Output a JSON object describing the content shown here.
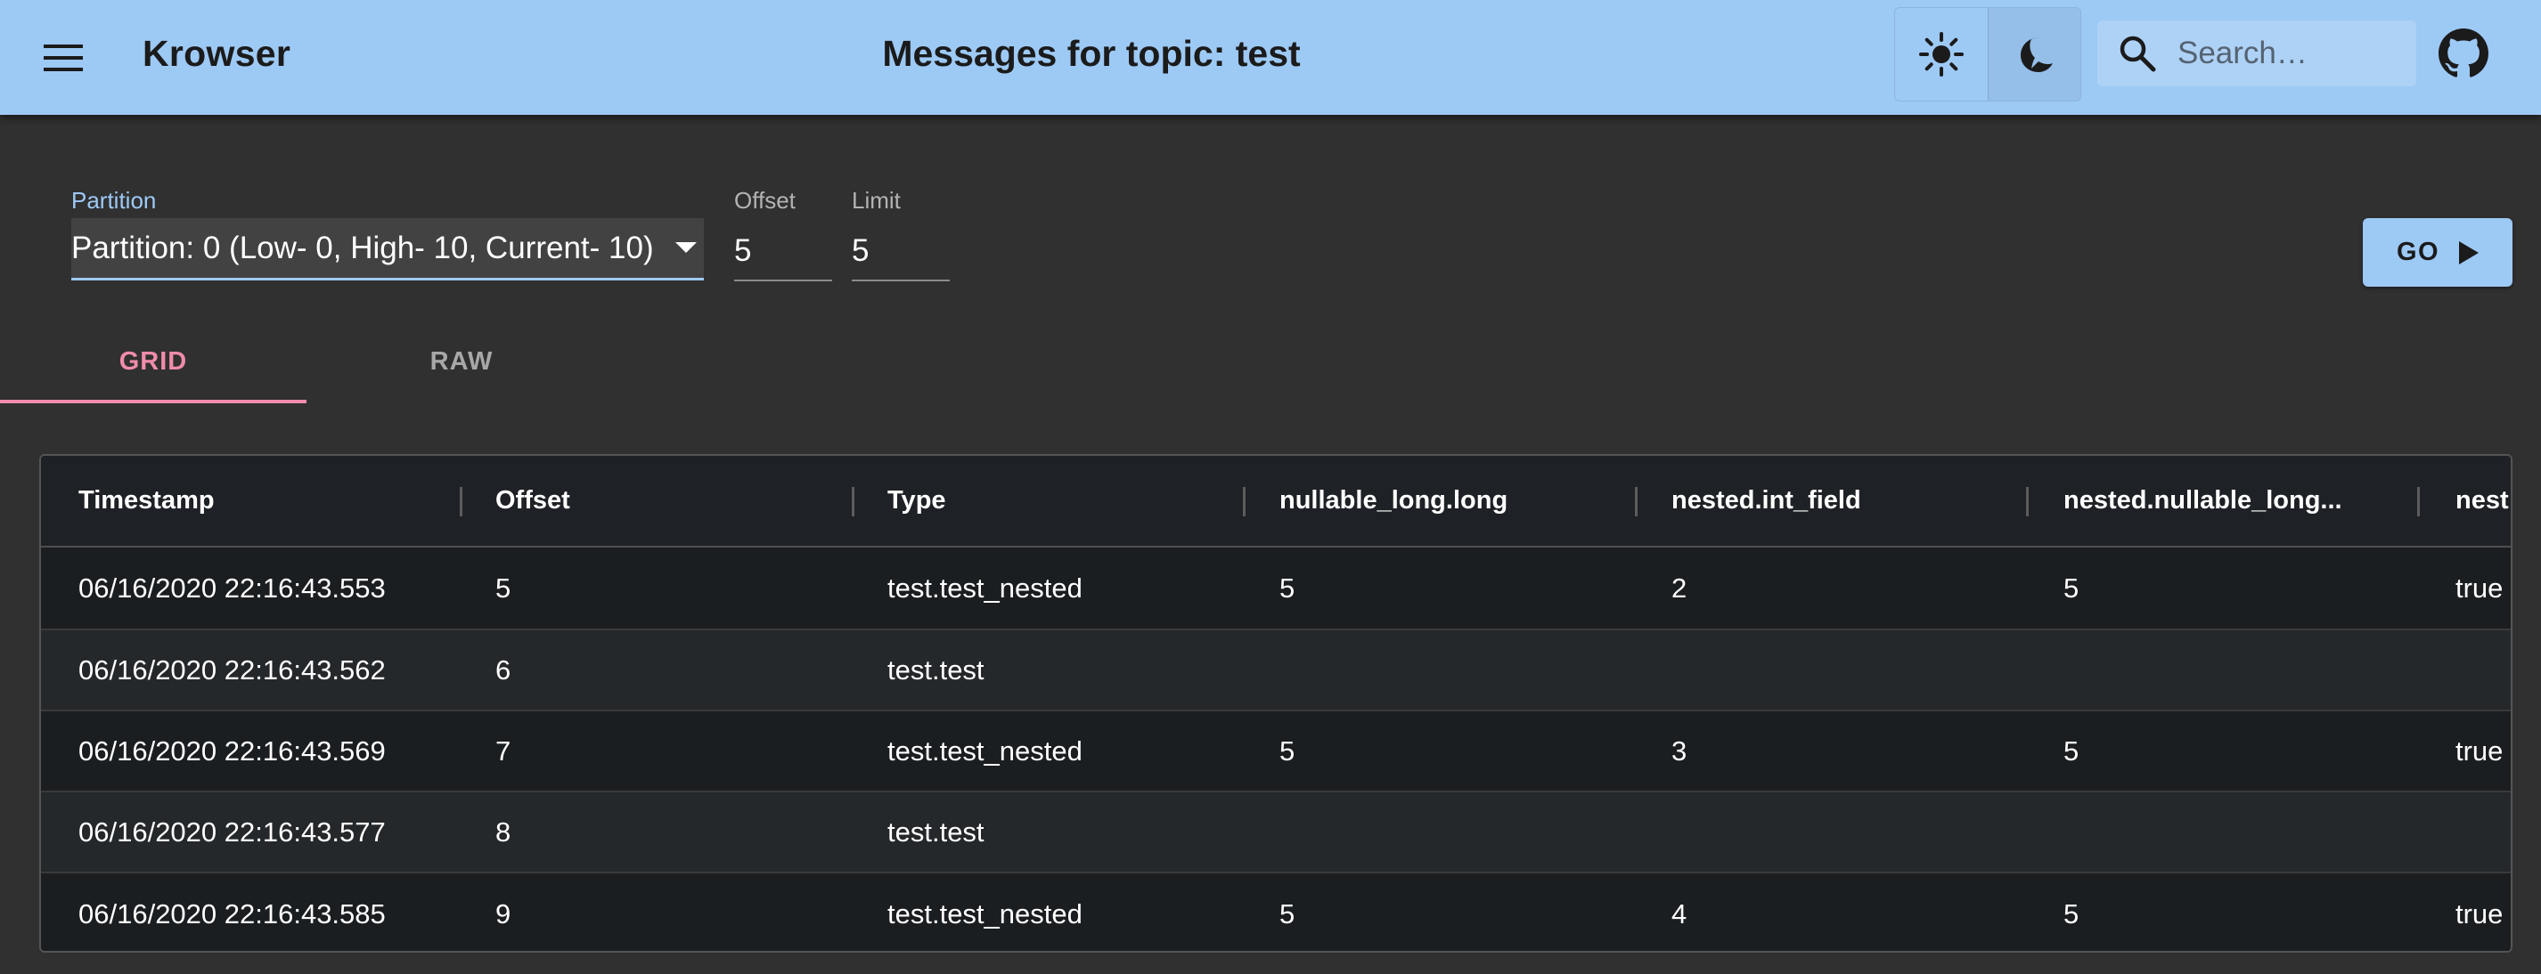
{
  "app": {
    "title": "Krowser",
    "page_title": "Messages for topic: test"
  },
  "header": {
    "light_theme_icon": "sun-icon",
    "dark_theme_icon": "moon-icon",
    "search_placeholder": "Search…",
    "github_icon": "github-icon"
  },
  "form": {
    "partition_label": "Partition",
    "partition_value": "Partition: 0 (Low- 0, High- 10, Current- 10)",
    "offset_label": "Offset",
    "offset_value": "5",
    "limit_label": "Limit",
    "limit_value": "5",
    "go_label": "GO"
  },
  "tabs": [
    {
      "label": "GRID",
      "active": true
    },
    {
      "label": "RAW",
      "active": false
    }
  ],
  "grid": {
    "columns": [
      "Timestamp",
      "Offset",
      "Type",
      "nullable_long.long",
      "nested.int_field",
      "nested.nullable_long...",
      "nest"
    ],
    "rows": [
      [
        "06/16/2020 22:16:43.553",
        "5",
        "test.test_nested",
        "5",
        "2",
        "5",
        "true"
      ],
      [
        "06/16/2020 22:16:43.562",
        "6",
        "test.test",
        "",
        "",
        "",
        ""
      ],
      [
        "06/16/2020 22:16:43.569",
        "7",
        "test.test_nested",
        "5",
        "3",
        "5",
        "true"
      ],
      [
        "06/16/2020 22:16:43.577",
        "8",
        "test.test",
        "",
        "",
        "",
        ""
      ],
      [
        "06/16/2020 22:16:43.585",
        "9",
        "test.test_nested",
        "5",
        "4",
        "5",
        "true"
      ]
    ]
  },
  "colors": {
    "appbar": "#9dc9f5",
    "background": "#303030",
    "accent_tab": "#f08cab",
    "grid_row_dark": "#1b1e21",
    "grid_row_alt": "#25282b"
  }
}
